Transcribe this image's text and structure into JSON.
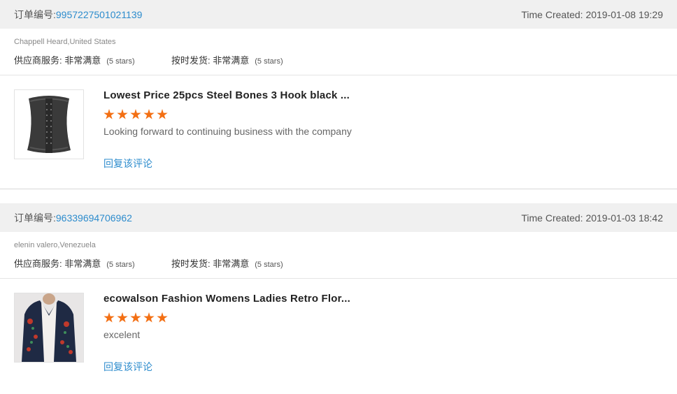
{
  "orders": [
    {
      "order_label": "订单编号:",
      "order_number": "9957227501021139",
      "time_label": "Time Created:",
      "time_value": "2019-01-08 19:29",
      "buyer": "Chappell Heard,United States",
      "service_label": "供应商服务:",
      "service_value": "非常满意",
      "service_stars": "(5 stars)",
      "shipping_label": "按时发货:",
      "shipping_value": "非常满意",
      "shipping_stars": "(5 stars)",
      "product_title": "Lowest Price 25pcs Steel Bones 3 Hook black ...",
      "rating": 5,
      "review": "Looking forward to continuing business with the company",
      "reply_label": "回复该评论"
    },
    {
      "order_label": "订单编号:",
      "order_number": "96339694706962",
      "time_label": "Time Created:",
      "time_value": "2019-01-03 18:42",
      "buyer": "elenin valero,Venezuela",
      "service_label": "供应商服务:",
      "service_value": "非常满意",
      "service_stars": "(5 stars)",
      "shipping_label": "按时发货:",
      "shipping_value": "非常满意",
      "shipping_stars": "(5 stars)",
      "product_title": "ecowalson Fashion Womens Ladies Retro Flor...",
      "rating": 5,
      "review": "excelent",
      "reply_label": "回复该评论"
    }
  ],
  "colors": {
    "link": "#2d8ccd",
    "star": "#f36f13",
    "header_bg": "#f0f0f0"
  }
}
